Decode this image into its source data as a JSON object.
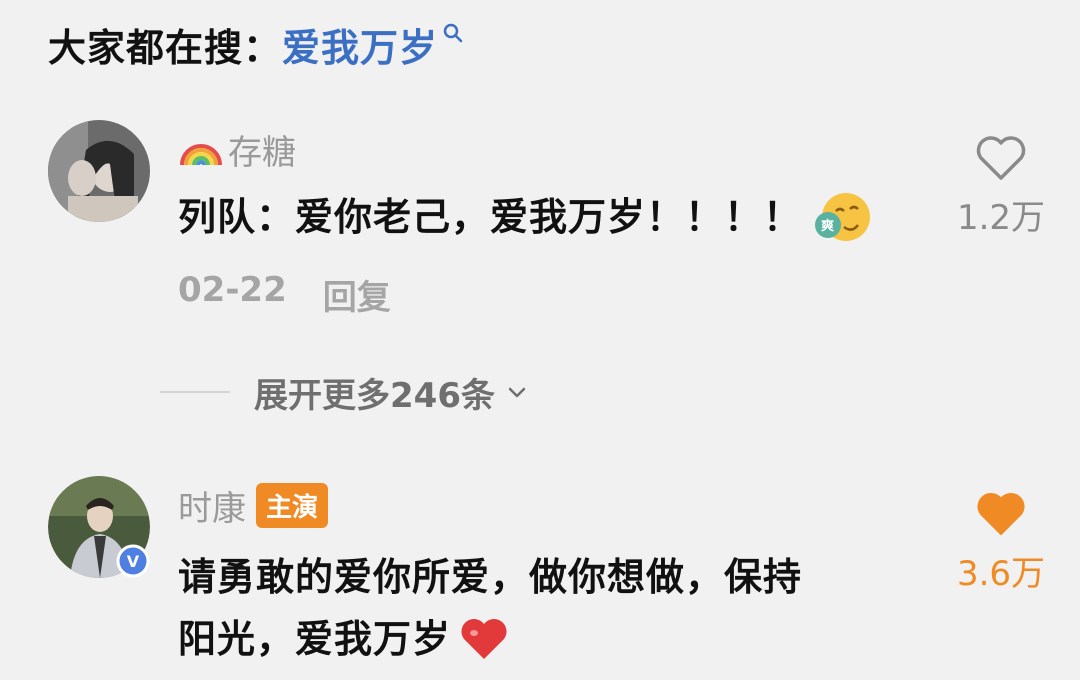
{
  "search": {
    "prefix": "大家都在搜：",
    "term": "爱我万岁"
  },
  "comments": [
    {
      "username": "存糖",
      "text": "列队：爱你老己，爱我万岁！！！！",
      "emoji_label": "爽",
      "date": "02-22",
      "reply_label": "回复",
      "like_count": "1.2万",
      "liked": false
    },
    {
      "username": "时康",
      "badge": "主演",
      "verified_mark": "V",
      "text_line1": "请勇敢的爱你所爱，做你想做，保持",
      "text_line2": "阳光，爱我万岁",
      "like_count": "3.6万",
      "liked": true
    }
  ],
  "expand": {
    "label": "展开更多246条"
  },
  "colors": {
    "background": "#f1f1f1",
    "link_blue": "#3a6fc4",
    "accent_orange": "#f08a24",
    "muted_gray": "#9a9a9a"
  }
}
